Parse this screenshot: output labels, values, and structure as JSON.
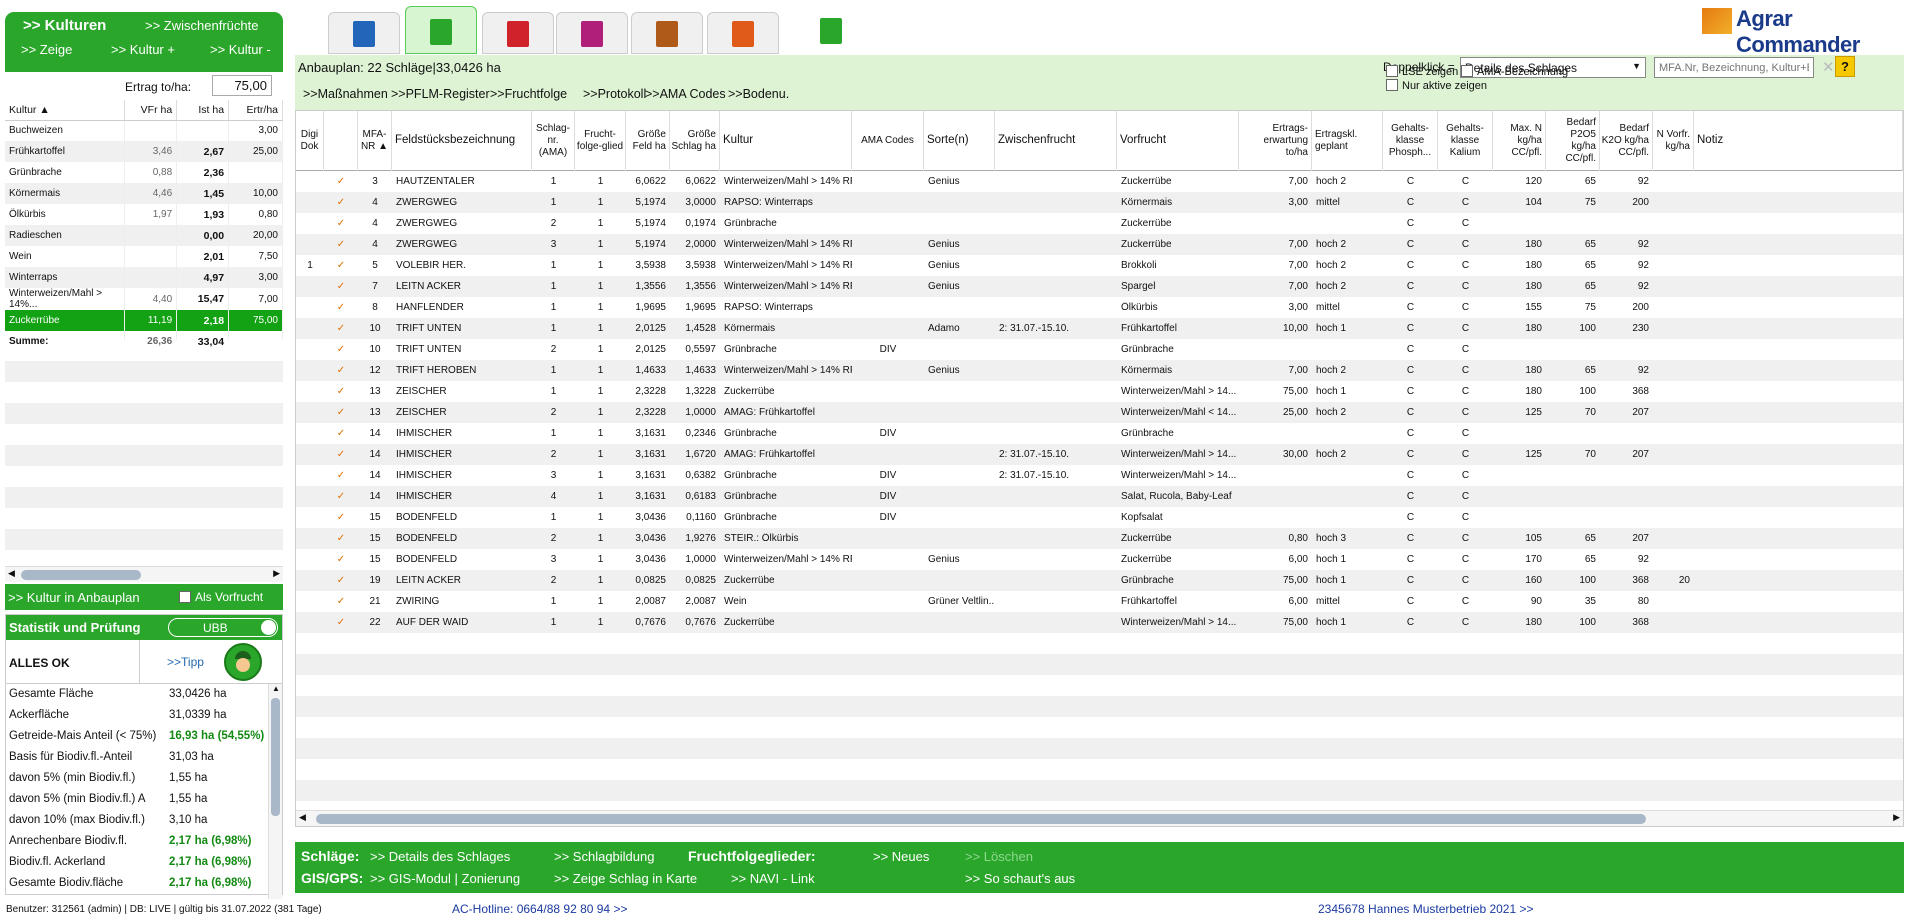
{
  "left": {
    "header_title": ">> Kulturen",
    "header_zwischen": ">> Zwischenfrüchte",
    "zeige": ">> Zeige",
    "kultur_plus": ">> Kultur +",
    "kultur_minus": ">> Kultur -",
    "ertrag_label": "Ertrag to/ha:",
    "ertrag_value": "75,00",
    "columns": [
      "Kultur ▲",
      "VFr ha",
      "Ist ha",
      "Ertr/ha"
    ],
    "rows": [
      [
        "Buchweizen",
        "",
        "",
        "3,00"
      ],
      [
        "Frühkartoffel",
        "3,46",
        "2,67",
        "25,00"
      ],
      [
        "Grünbrache",
        "0,88",
        "2,36",
        ""
      ],
      [
        "Körnermais",
        "4,46",
        "1,45",
        "10,00"
      ],
      [
        "Ölkürbis",
        "1,97",
        "1,93",
        "0,80"
      ],
      [
        "Radieschen",
        "",
        "0,00",
        "20,00"
      ],
      [
        "Wein",
        "",
        "2,01",
        "7,50"
      ],
      [
        "Winterraps",
        "",
        "4,97",
        "3,00"
      ],
      [
        "Winterweizen/Mahl > 14%...",
        "4,40",
        "15,47",
        "7,00"
      ],
      [
        "Zuckerrübe",
        "11,19",
        "2,18",
        "75,00"
      ],
      [
        "Summe:",
        "26,36",
        "33,04",
        ""
      ]
    ],
    "kultur_in_anbauplan": ">> Kultur in Anbauplan",
    "als_vorfrucht": "Als Vorfrucht",
    "stat_title": "Statistik und Prüfung",
    "ubb": "UBB",
    "alles_ok": "ALLES OK",
    "tipp": ">>Tipp",
    "stats": [
      [
        "Gesamte Fläche",
        "33,0426 ha",
        false
      ],
      [
        "Ackerfläche",
        "31,0339 ha",
        false
      ],
      [
        "Getreide-Mais Anteil (< 75%)",
        "16,93 ha (54,55%)",
        true
      ],
      [
        "Basis für Biodiv.fl.-Anteil",
        "31,03 ha",
        false
      ],
      [
        "davon 5% (min Biodiv.fl.)",
        "1,55 ha",
        false
      ],
      [
        "davon 5% (min Biodiv.fl.) A",
        "1,55 ha",
        false
      ],
      [
        "davon 10% (max Biodiv.fl.)",
        "3,10 ha",
        false
      ],
      [
        "Anrechenbare Biodiv.fl.",
        "2,17 ha (6,98%)",
        true
      ],
      [
        "Biodiv.fl. Ackerland",
        "2,17 ha (6,98%)",
        true
      ],
      [
        "Gesamte Biodiv.fläche",
        "2,17 ha (6,98%)",
        true
      ]
    ]
  },
  "logo": {
    "part1": "Agrar",
    "part2": "Commander"
  },
  "top": {
    "anbauplan": "Anbauplan: 22 Schläge|33,0426 ha",
    "doppelklick_label": "Doppelklick =",
    "doppelklick_value": "Details des Schlages",
    "search_placeholder": "MFA.Nr, Bezeichnung, Kultur+ENTER",
    "help": "?",
    "links": [
      ">>Maßnahmen",
      ">>PFLM-Register",
      ">>Fruchtfolge",
      ">>Protokoll",
      ">>AMA Codes",
      ">>Bodenu."
    ],
    "lse": "LSE zeigen",
    "ama_bez": "AMA-Bezeichnung",
    "nur_aktive": "Nur aktive zeigen"
  },
  "grid": {
    "headers": [
      "Digi Dok",
      "",
      "MFA-NR ▲",
      "Feldstücksbezeichnung",
      "Schlag-nr. (AMA)",
      "Frucht-folge-glied",
      "Größe Feld ha",
      "Größe Schlag ha",
      "Kultur",
      "AMA Codes",
      "Sorte(n)",
      "Zwischenfrucht",
      "Vorfrucht",
      "Ertrags-erwartung to/ha",
      "Ertragskl. geplant",
      "Gehalts-klasse Phosph...",
      "Gehalts-klasse Kalium",
      "Max. N kg/ha CC/pfl.",
      "Bedarf P2O5 kg/ha CC/pfl.",
      "Bedarf K2O kg/ha CC/pfl.",
      "N Vorfr. kg/ha",
      "Notiz"
    ],
    "rows": [
      [
        "",
        "✓",
        "3",
        "HAUTZENTALER",
        "1",
        "1",
        "6,0622",
        "6,0622",
        "Winterweizen/Mahl > 14% RP",
        "",
        "Genius",
        "",
        "Zuckerrübe",
        "7,00",
        "hoch 2",
        "C",
        "C",
        "120",
        "65",
        "92",
        "",
        ""
      ],
      [
        "",
        "✓",
        "4",
        "ZWERGWEG",
        "1",
        "1",
        "5,1974",
        "3,0000",
        "RAPSO: Winterraps",
        "",
        "",
        "",
        "Körnermais",
        "3,00",
        "mittel",
        "C",
        "C",
        "104",
        "75",
        "200",
        "",
        ""
      ],
      [
        "",
        "✓",
        "4",
        "ZWERGWEG",
        "2",
        "1",
        "5,1974",
        "0,1974",
        "Grünbrache",
        "",
        "",
        "",
        "Zuckerrübe",
        "",
        "",
        "C",
        "C",
        "",
        "",
        "",
        "",
        ""
      ],
      [
        "",
        "✓",
        "4",
        "ZWERGWEG",
        "3",
        "1",
        "5,1974",
        "2,0000",
        "Winterweizen/Mahl > 14% RP",
        "",
        "Genius",
        "",
        "Zuckerrübe",
        "7,00",
        "hoch 2",
        "C",
        "C",
        "180",
        "65",
        "92",
        "",
        ""
      ],
      [
        "1",
        "✓",
        "5",
        "VOLEBIR HER.",
        "1",
        "1",
        "3,5938",
        "3,5938",
        "Winterweizen/Mahl > 14% RP",
        "",
        "Genius",
        "",
        "Brokkoli",
        "7,00",
        "hoch 2",
        "C",
        "C",
        "180",
        "65",
        "92",
        "",
        ""
      ],
      [
        "",
        "✓",
        "7",
        "LEITN ACKER",
        "1",
        "1",
        "1,3556",
        "1,3556",
        "Winterweizen/Mahl > 14% RP",
        "",
        "Genius",
        "",
        "Spargel",
        "7,00",
        "hoch 2",
        "C",
        "C",
        "180",
        "65",
        "92",
        "",
        ""
      ],
      [
        "",
        "✓",
        "8",
        "HANFLENDER",
        "1",
        "1",
        "1,9695",
        "1,9695",
        "RAPSO: Winterraps",
        "",
        "",
        "",
        "Ölkürbis",
        "3,00",
        "mittel",
        "C",
        "C",
        "155",
        "75",
        "200",
        "",
        ""
      ],
      [
        "",
        "✓",
        "10",
        "TRIFT UNTEN",
        "1",
        "1",
        "2,0125",
        "1,4528",
        "Körnermais",
        "",
        "Adamo",
        "2: 31.07.-15.10.",
        "Frühkartoffel",
        "10,00",
        "hoch 1",
        "C",
        "C",
        "180",
        "100",
        "230",
        "",
        ""
      ],
      [
        "",
        "✓",
        "10",
        "TRIFT UNTEN",
        "2",
        "1",
        "2,0125",
        "0,5597",
        "Grünbrache",
        "DIV",
        "",
        "",
        "Grünbrache",
        "",
        "",
        "C",
        "C",
        "",
        "",
        "",
        "",
        ""
      ],
      [
        "",
        "✓",
        "12",
        "TRIFT HEROBEN",
        "1",
        "1",
        "1,4633",
        "1,4633",
        "Winterweizen/Mahl > 14% RP",
        "",
        "Genius",
        "",
        "Körnermais",
        "7,00",
        "hoch 2",
        "C",
        "C",
        "180",
        "65",
        "92",
        "",
        ""
      ],
      [
        "",
        "✓",
        "13",
        "ZEISCHER",
        "1",
        "1",
        "2,3228",
        "1,3228",
        "Zuckerrübe",
        "",
        "",
        "",
        "Winterweizen/Mahl > 14...",
        "75,00",
        "hoch 1",
        "C",
        "C",
        "180",
        "100",
        "368",
        "",
        ""
      ],
      [
        "",
        "✓",
        "13",
        "ZEISCHER",
        "2",
        "1",
        "2,3228",
        "1,0000",
        "AMAG: Frühkartoffel",
        "",
        "",
        "",
        "Winterweizen/Mahl < 14...",
        "25,00",
        "hoch 2",
        "C",
        "C",
        "125",
        "70",
        "207",
        "",
        ""
      ],
      [
        "",
        "✓",
        "14",
        "IHMISCHER",
        "1",
        "1",
        "3,1631",
        "0,2346",
        "Grünbrache",
        "DIV",
        "",
        "",
        "Grünbrache",
        "",
        "",
        "C",
        "C",
        "",
        "",
        "",
        "",
        ""
      ],
      [
        "",
        "✓",
        "14",
        "IHMISCHER",
        "2",
        "1",
        "3,1631",
        "1,6720",
        "AMAG: Frühkartoffel",
        "",
        "",
        "2: 31.07.-15.10.",
        "Winterweizen/Mahl > 14...",
        "30,00",
        "hoch 2",
        "C",
        "C",
        "125",
        "70",
        "207",
        "",
        ""
      ],
      [
        "",
        "✓",
        "14",
        "IHMISCHER",
        "3",
        "1",
        "3,1631",
        "0,6382",
        "Grünbrache",
        "DIV",
        "",
        "2: 31.07.-15.10.",
        "Winterweizen/Mahl > 14...",
        "",
        "",
        "C",
        "C",
        "",
        "",
        "",
        "",
        ""
      ],
      [
        "",
        "✓",
        "14",
        "IHMISCHER",
        "4",
        "1",
        "3,1631",
        "0,6183",
        "Grünbrache",
        "DIV",
        "",
        "",
        "Salat, Rucola, Baby-Leaf",
        "",
        "",
        "C",
        "C",
        "",
        "",
        "",
        "",
        ""
      ],
      [
        "",
        "✓",
        "15",
        "BODENFELD",
        "1",
        "1",
        "3,0436",
        "0,1160",
        "Grünbrache",
        "DIV",
        "",
        "",
        "Kopfsalat",
        "",
        "",
        "C",
        "C",
        "",
        "",
        "",
        "",
        ""
      ],
      [
        "",
        "✓",
        "15",
        "BODENFELD",
        "2",
        "1",
        "3,0436",
        "1,9276",
        "STEIR.: Ölkürbis",
        "",
        "",
        "",
        "Zuckerrübe",
        "0,80",
        "hoch 3",
        "C",
        "C",
        "105",
        "65",
        "207",
        "",
        ""
      ],
      [
        "",
        "✓",
        "15",
        "BODENFELD",
        "3",
        "1",
        "3,0436",
        "1,0000",
        "Winterweizen/Mahl > 14% RP",
        "",
        "Genius",
        "",
        "Zuckerrübe",
        "6,00",
        "hoch 1",
        "C",
        "C",
        "170",
        "65",
        "92",
        "",
        ""
      ],
      [
        "",
        "✓",
        "19",
        "LEITN ACKER",
        "2",
        "1",
        "0,0825",
        "0,0825",
        "Zuckerrübe",
        "",
        "",
        "",
        "Grünbrache",
        "75,00",
        "hoch 1",
        "C",
        "C",
        "160",
        "100",
        "368",
        "20",
        ""
      ],
      [
        "",
        "✓",
        "21",
        "ZWIRING",
        "1",
        "1",
        "2,0087",
        "2,0087",
        "Wein",
        "",
        "Grüner Veltlin...",
        "",
        "Frühkartoffel",
        "6,00",
        "mittel",
        "C",
        "C",
        "90",
        "35",
        "80",
        "",
        ""
      ],
      [
        "",
        "✓",
        "22",
        "AUF DER WAID",
        "1",
        "1",
        "0,7676",
        "0,7676",
        "Zuckerrübe",
        "",
        "",
        "",
        "Winterweizen/Mahl > 14...",
        "75,00",
        "hoch 1",
        "C",
        "C",
        "180",
        "100",
        "368",
        "",
        ""
      ]
    ]
  },
  "bottom": {
    "schlaege": "Schläge:",
    "details": ">> Details des Schlages",
    "schlagbildung": ">> Schlagbildung",
    "fruchtfolgeglieder": "Fruchtfolgeglieder:",
    "neues": ">> Neues",
    "loeschen": ">> Löschen",
    "gisgps": "GIS/GPS:",
    "gismodul": ">> GIS-Modul | Zonierung",
    "zeige_schlag": ">> Zeige Schlag in Karte",
    "navi": ">> NAVI - Link",
    "so_schauts": ">> So schaut's aus"
  },
  "footer": {
    "user": "Benutzer: 312561 (admin) | DB: LIVE | gültig bis 31.07.2022 (381 Tage)",
    "hotline": "AC-Hotline: 0664/88 92 80 94 >>",
    "betrieb": "2345678 Hannes Musterbetrieb 2021 >>"
  }
}
